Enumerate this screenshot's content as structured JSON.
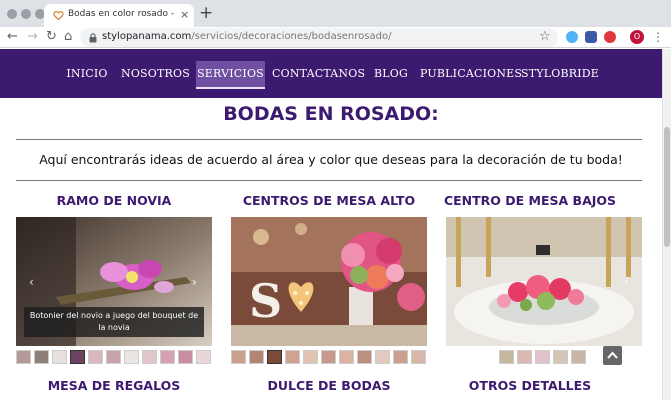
{
  "browser": {
    "tab_title": "Bodas en color rosado - Stylo P",
    "tab_close": "×",
    "new_tab": "+",
    "url_host": "stylopanama.com",
    "url_path": "/servicios/decoraciones/bodasenrosado/",
    "back": "←",
    "forward": "→",
    "reload": "↻",
    "home": "⌂",
    "star": "☆",
    "profile_initial": "O",
    "menu": "⋮"
  },
  "nav": {
    "items": [
      "INICIO",
      "NOSOTROS",
      "SERVICIOS",
      "CONTACTANOS",
      "BLOG",
      "PUBLICACIONES",
      "STYLOBRIDE"
    ],
    "active_index": 2
  },
  "page": {
    "title": "BODAS EN ROSADO:",
    "intro": "Aquí encontrarás ideas de acuerdo al área y color que deseas para la decoración de tu boda!"
  },
  "sections": [
    {
      "title": "RAMO DE NOVIA",
      "caption": "Botonier del novio a juego del bouquet de la novia",
      "prev": "‹",
      "next": "›"
    },
    {
      "title": "CENTROS DE MESA ALTO"
    },
    {
      "title": "CENTRO DE MESA BAJOS",
      "next": "›"
    },
    {
      "title": "MESA DE REGALOS"
    },
    {
      "title": "DULCE DE BODAS"
    },
    {
      "title": "OTROS DETALLES"
    }
  ],
  "colors": {
    "brand_purple": "#3c1a6f",
    "nav_active": "#6e4fa2"
  }
}
